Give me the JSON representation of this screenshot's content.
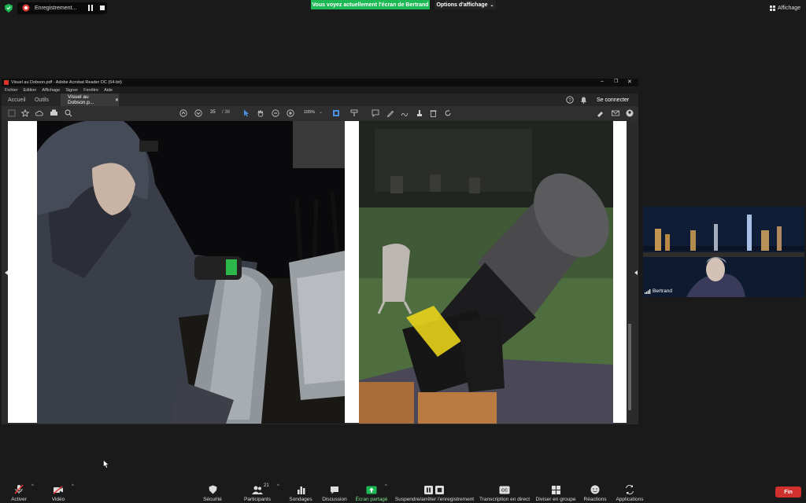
{
  "zoom": {
    "recording_label": "Enregistrement...",
    "share_banner": "Vous voyez actuellement l'écran de Bertrand",
    "view_options": "Options d'affichage",
    "view_button": "Affichage",
    "participant_name": "Bertrand",
    "participants_count": "21",
    "end_button": "Fin",
    "toolbar": [
      {
        "key": "mute",
        "label": "Activer",
        "icon": "mic-muted-icon"
      },
      {
        "key": "video",
        "label": "Vidéo",
        "icon": "video-off-icon"
      },
      {
        "key": "security",
        "label": "Sécurité",
        "icon": "shield-icon"
      },
      {
        "key": "participants",
        "label": "Participants",
        "icon": "participants-icon"
      },
      {
        "key": "polls",
        "label": "Sondages",
        "icon": "bar-chart-icon"
      },
      {
        "key": "chat",
        "label": "Discussion",
        "icon": "chat-icon"
      },
      {
        "key": "share",
        "label": "Écran partagé",
        "icon": "share-screen-icon"
      },
      {
        "key": "record",
        "label": "Suspendre/arrêter l'enregistrement",
        "icon": "record-pause-icon"
      },
      {
        "key": "captions",
        "label": "Transcription en direct",
        "icon": "cc-icon"
      },
      {
        "key": "breakout",
        "label": "Diviser en groupe",
        "icon": "breakout-icon"
      },
      {
        "key": "reactions",
        "label": "Réactions",
        "icon": "smile-icon"
      },
      {
        "key": "apps",
        "label": "Applications",
        "icon": "apps-icon"
      }
    ],
    "colors": {
      "share_green": "#1db954",
      "end_red": "#d0312d"
    }
  },
  "acrobat": {
    "title": "Visuel au Dobson.pdf - Adobe Acrobat Reader DC (64-bit)",
    "menu": [
      "Fichier",
      "Edition",
      "Affichage",
      "Signer",
      "Fenêtre",
      "Aide"
    ],
    "tabs": {
      "home": "Accueil",
      "tools": "Outils",
      "doc": "Visuel au Dobson.p..."
    },
    "signin": "Se connecter",
    "page_current": "35",
    "page_total": "/ 36",
    "zoom": "105%"
  }
}
